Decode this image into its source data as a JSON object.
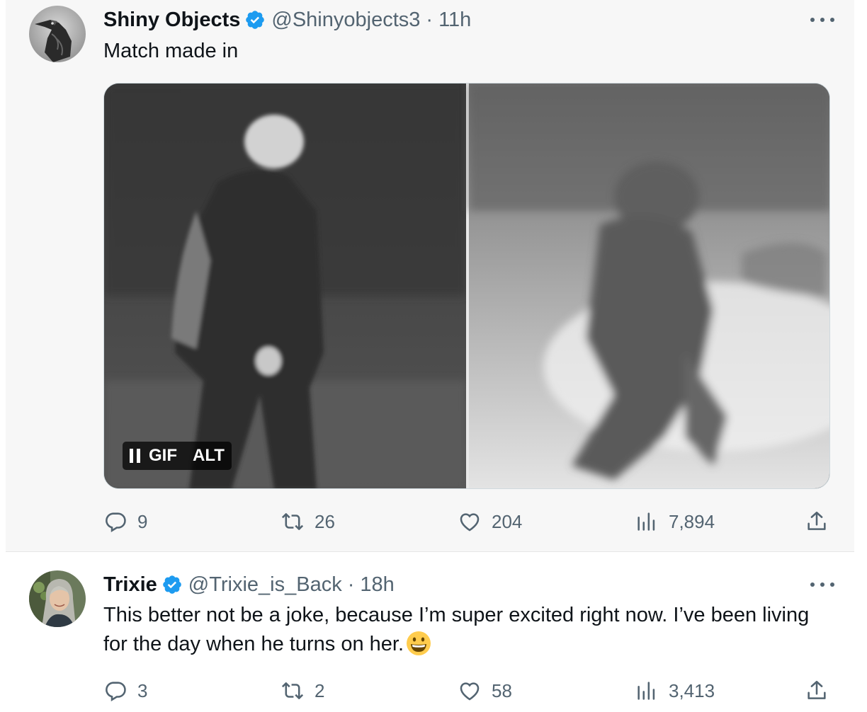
{
  "tweets": [
    {
      "avatar_icon": "raven-avatar",
      "name": "Shiny Objects",
      "verified_icon": "verified-badge-icon",
      "handle": "@Shinyobjects3",
      "separator": "·",
      "time": "11h",
      "text": "Match made in",
      "media": {
        "type": "GIF",
        "gif_label": "GIF",
        "alt_label": "ALT",
        "pause_icon": "pause-icon"
      },
      "actions": {
        "replies": "9",
        "retweets": "26",
        "likes": "204",
        "views": "7,894"
      }
    },
    {
      "avatar_icon": "woman-avatar",
      "name": "Trixie",
      "verified_icon": "verified-badge-icon",
      "handle": "@Trixie_is_Back",
      "separator": "·",
      "time": "18h",
      "text": "This better not be a joke, because I’m super excited right now. I’ve been living for the day when he turns on her.",
      "emoji": "grinning-face-icon",
      "actions": {
        "replies": "3",
        "retweets": "2",
        "likes": "58",
        "views": "3,413"
      }
    }
  ],
  "colors": {
    "text": "#0f1419",
    "secondary": "#536471",
    "verified": "#1d9bf0",
    "tweet_bg_highlight": "#f7f7f7"
  }
}
